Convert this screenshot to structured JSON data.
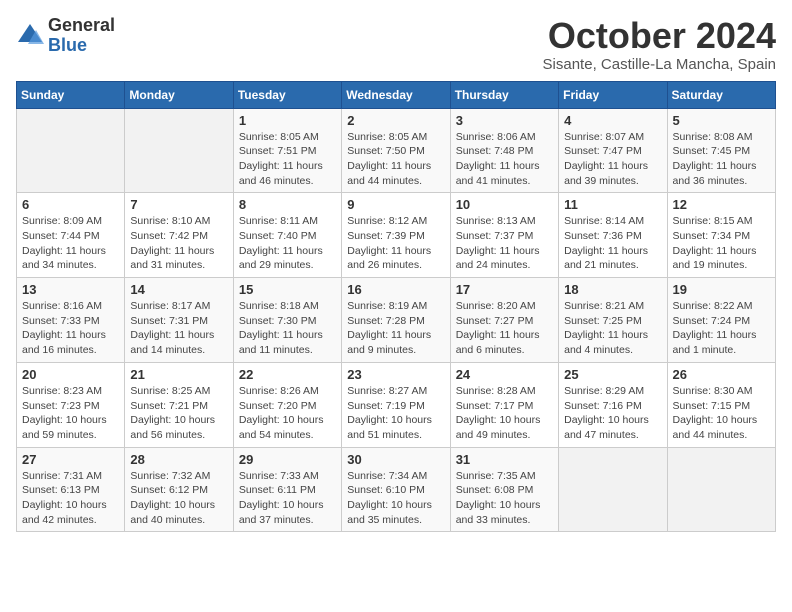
{
  "logo": {
    "general": "General",
    "blue": "Blue"
  },
  "header": {
    "month": "October 2024",
    "location": "Sisante, Castille-La Mancha, Spain"
  },
  "weekdays": [
    "Sunday",
    "Monday",
    "Tuesday",
    "Wednesday",
    "Thursday",
    "Friday",
    "Saturday"
  ],
  "weeks": [
    [
      {
        "day": "",
        "info": ""
      },
      {
        "day": "",
        "info": ""
      },
      {
        "day": "1",
        "info": "Sunrise: 8:05 AM\nSunset: 7:51 PM\nDaylight: 11 hours and 46 minutes."
      },
      {
        "day": "2",
        "info": "Sunrise: 8:05 AM\nSunset: 7:50 PM\nDaylight: 11 hours and 44 minutes."
      },
      {
        "day": "3",
        "info": "Sunrise: 8:06 AM\nSunset: 7:48 PM\nDaylight: 11 hours and 41 minutes."
      },
      {
        "day": "4",
        "info": "Sunrise: 8:07 AM\nSunset: 7:47 PM\nDaylight: 11 hours and 39 minutes."
      },
      {
        "day": "5",
        "info": "Sunrise: 8:08 AM\nSunset: 7:45 PM\nDaylight: 11 hours and 36 minutes."
      }
    ],
    [
      {
        "day": "6",
        "info": "Sunrise: 8:09 AM\nSunset: 7:44 PM\nDaylight: 11 hours and 34 minutes."
      },
      {
        "day": "7",
        "info": "Sunrise: 8:10 AM\nSunset: 7:42 PM\nDaylight: 11 hours and 31 minutes."
      },
      {
        "day": "8",
        "info": "Sunrise: 8:11 AM\nSunset: 7:40 PM\nDaylight: 11 hours and 29 minutes."
      },
      {
        "day": "9",
        "info": "Sunrise: 8:12 AM\nSunset: 7:39 PM\nDaylight: 11 hours and 26 minutes."
      },
      {
        "day": "10",
        "info": "Sunrise: 8:13 AM\nSunset: 7:37 PM\nDaylight: 11 hours and 24 minutes."
      },
      {
        "day": "11",
        "info": "Sunrise: 8:14 AM\nSunset: 7:36 PM\nDaylight: 11 hours and 21 minutes."
      },
      {
        "day": "12",
        "info": "Sunrise: 8:15 AM\nSunset: 7:34 PM\nDaylight: 11 hours and 19 minutes."
      }
    ],
    [
      {
        "day": "13",
        "info": "Sunrise: 8:16 AM\nSunset: 7:33 PM\nDaylight: 11 hours and 16 minutes."
      },
      {
        "day": "14",
        "info": "Sunrise: 8:17 AM\nSunset: 7:31 PM\nDaylight: 11 hours and 14 minutes."
      },
      {
        "day": "15",
        "info": "Sunrise: 8:18 AM\nSunset: 7:30 PM\nDaylight: 11 hours and 11 minutes."
      },
      {
        "day": "16",
        "info": "Sunrise: 8:19 AM\nSunset: 7:28 PM\nDaylight: 11 hours and 9 minutes."
      },
      {
        "day": "17",
        "info": "Sunrise: 8:20 AM\nSunset: 7:27 PM\nDaylight: 11 hours and 6 minutes."
      },
      {
        "day": "18",
        "info": "Sunrise: 8:21 AM\nSunset: 7:25 PM\nDaylight: 11 hours and 4 minutes."
      },
      {
        "day": "19",
        "info": "Sunrise: 8:22 AM\nSunset: 7:24 PM\nDaylight: 11 hours and 1 minute."
      }
    ],
    [
      {
        "day": "20",
        "info": "Sunrise: 8:23 AM\nSunset: 7:23 PM\nDaylight: 10 hours and 59 minutes."
      },
      {
        "day": "21",
        "info": "Sunrise: 8:25 AM\nSunset: 7:21 PM\nDaylight: 10 hours and 56 minutes."
      },
      {
        "day": "22",
        "info": "Sunrise: 8:26 AM\nSunset: 7:20 PM\nDaylight: 10 hours and 54 minutes."
      },
      {
        "day": "23",
        "info": "Sunrise: 8:27 AM\nSunset: 7:19 PM\nDaylight: 10 hours and 51 minutes."
      },
      {
        "day": "24",
        "info": "Sunrise: 8:28 AM\nSunset: 7:17 PM\nDaylight: 10 hours and 49 minutes."
      },
      {
        "day": "25",
        "info": "Sunrise: 8:29 AM\nSunset: 7:16 PM\nDaylight: 10 hours and 47 minutes."
      },
      {
        "day": "26",
        "info": "Sunrise: 8:30 AM\nSunset: 7:15 PM\nDaylight: 10 hours and 44 minutes."
      }
    ],
    [
      {
        "day": "27",
        "info": "Sunrise: 7:31 AM\nSunset: 6:13 PM\nDaylight: 10 hours and 42 minutes."
      },
      {
        "day": "28",
        "info": "Sunrise: 7:32 AM\nSunset: 6:12 PM\nDaylight: 10 hours and 40 minutes."
      },
      {
        "day": "29",
        "info": "Sunrise: 7:33 AM\nSunset: 6:11 PM\nDaylight: 10 hours and 37 minutes."
      },
      {
        "day": "30",
        "info": "Sunrise: 7:34 AM\nSunset: 6:10 PM\nDaylight: 10 hours and 35 minutes."
      },
      {
        "day": "31",
        "info": "Sunrise: 7:35 AM\nSunset: 6:08 PM\nDaylight: 10 hours and 33 minutes."
      },
      {
        "day": "",
        "info": ""
      },
      {
        "day": "",
        "info": ""
      }
    ]
  ]
}
